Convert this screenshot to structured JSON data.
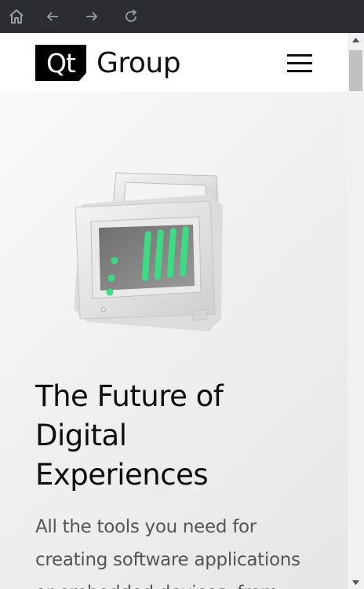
{
  "browser": {
    "icons": [
      "home-icon",
      "back-arrow-icon",
      "forward-arrow-icon",
      "reload-icon"
    ]
  },
  "header": {
    "logo_mark": "Qt",
    "logo_text": "Group",
    "menu_icon": "hamburger-menu-icon"
  },
  "hero": {
    "title_lines": [
      "The Future of",
      "Digital",
      "Experiences"
    ],
    "description_lines": [
      "All the tools you need for",
      "creating software applications",
      "or embedded devices, from"
    ]
  },
  "colors": {
    "browser_bar": "#2b2d31",
    "accent_green": "#3ddc84",
    "text_dark": "#0d0d0d",
    "text_muted": "#555555"
  }
}
